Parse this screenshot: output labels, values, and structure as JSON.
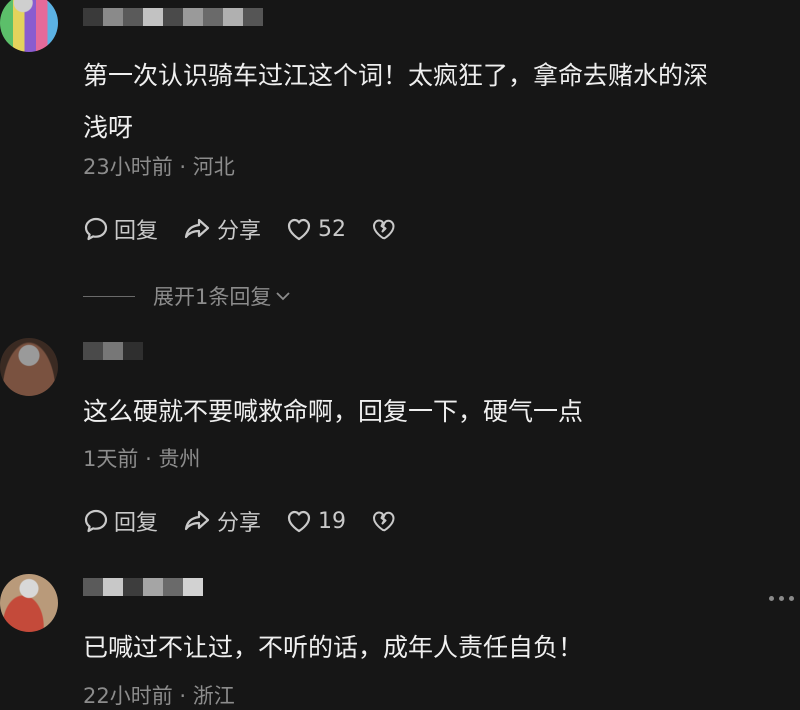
{
  "comments": [
    {
      "text": "第一次认识骑车过江这个词！太疯狂了，拿命去赌水的深\n浅呀",
      "time": "23小时前",
      "region": "河北",
      "reply_label": "回复",
      "share_label": "分享",
      "likes": "52",
      "expand_label": "展开1条回复"
    },
    {
      "text": "这么硬就不要喊救命啊，回复一下，硬气一点",
      "time": "1天前",
      "region": "贵州",
      "reply_label": "回复",
      "share_label": "分享",
      "likes": "19"
    },
    {
      "text": "已喊过不让过，不听的话，成年人责任自负！",
      "time": "22小时前",
      "region": "浙江"
    }
  ],
  "separator": "·",
  "icons": {
    "reply": "comment-bubble-icon",
    "share": "share-arrow-icon",
    "like": "heart-icon",
    "dislike": "broken-heart-icon",
    "expand": "chevron-down-icon",
    "more": "more-dots-icon"
  },
  "colors": {
    "background": "#161616",
    "text": "#efefef",
    "meta": "#8c8c8c",
    "action": "#c9c9c9"
  }
}
